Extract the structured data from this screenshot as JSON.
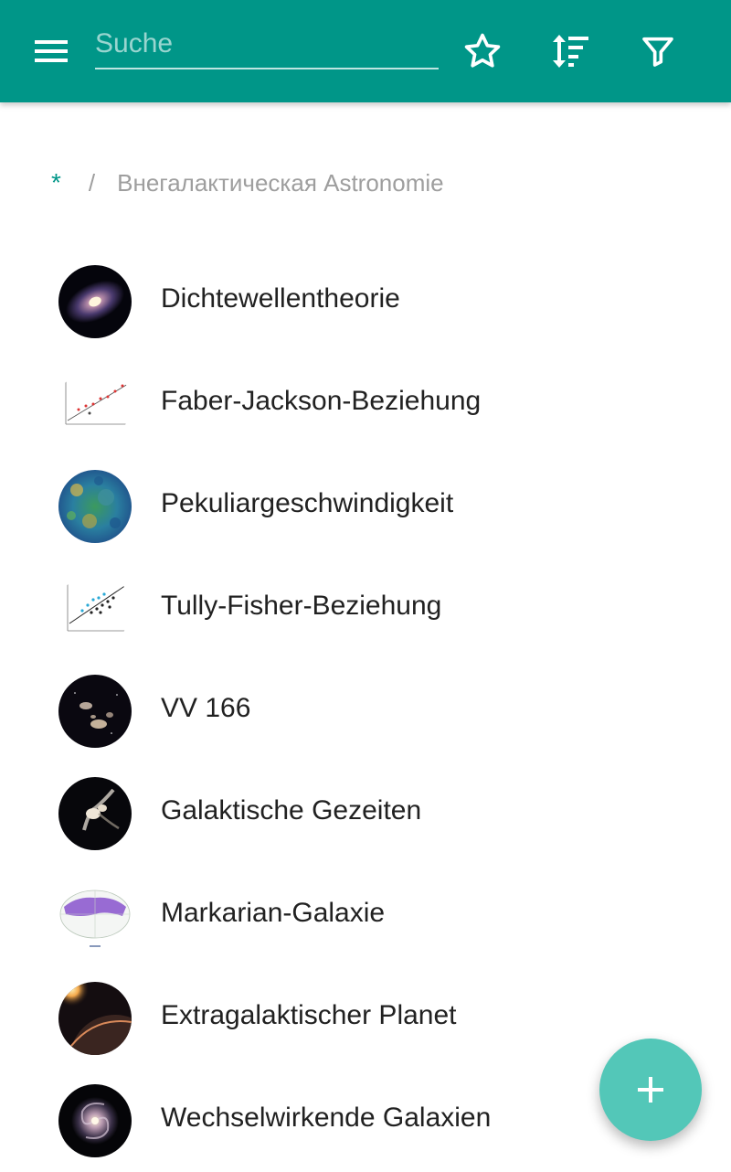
{
  "appbar": {
    "menu_icon": "hamburger-menu-icon",
    "search_placeholder": "Suche",
    "search_value": "",
    "favorite_icon": "star-outline-icon",
    "sort_icon": "sort-icon",
    "filter_icon": "filter-icon",
    "color": "#009688"
  },
  "breadcrumb": {
    "root": "*",
    "separator": "/",
    "current": "Внегалактическая Astronomie"
  },
  "items": [
    {
      "label": "Dichtewellentheorie",
      "thumb": "spiral-galaxy-image"
    },
    {
      "label": "Faber-Jackson-Beziehung",
      "thumb": "scatter-plot-image"
    },
    {
      "label": "Pekuliargeschwindigkeit",
      "thumb": "cosmic-background-map-image"
    },
    {
      "label": "Tully-Fisher-Beziehung",
      "thumb": "regression-plot-image"
    },
    {
      "label": "VV 166",
      "thumb": "galaxy-group-image"
    },
    {
      "label": "Galaktische Gezeiten",
      "thumb": "interacting-galaxies-image"
    },
    {
      "label": "Markarian-Galaxie",
      "thumb": "sky-survey-map-image"
    },
    {
      "label": "Extragalaktischer Planet",
      "thumb": "planet-illustration-image"
    },
    {
      "label": "Wechselwirkende Galaxien",
      "thumb": "whirlpool-galaxy-image"
    }
  ],
  "fab": {
    "icon": "plus-icon",
    "color": "#53c7b8"
  }
}
